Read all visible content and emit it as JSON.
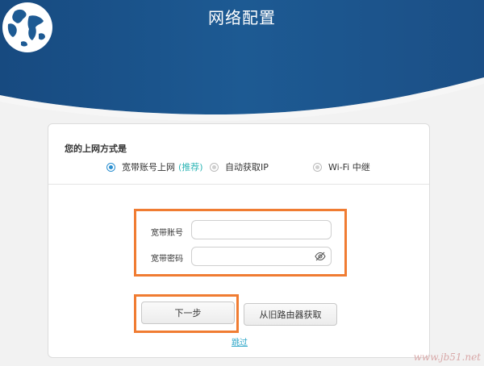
{
  "header": {
    "title": "网络配置"
  },
  "form": {
    "question": "您的上网方式是",
    "options": [
      {
        "label": "宽带账号上网",
        "tag": "(推荐)",
        "selected": true
      },
      {
        "label": "自动获取IP",
        "selected": false
      },
      {
        "label": "Wi-Fi 中继",
        "selected": false
      }
    ],
    "account_label": "宽带账号",
    "account_value": "",
    "password_label": "宽带密码",
    "password_value": ""
  },
  "actions": {
    "next_label": "下一步",
    "import_label": "从旧路由器获取",
    "skip_label": "跳过"
  },
  "watermark": "www.jb51.net",
  "colors": {
    "header_blue": "#1d4f86",
    "highlight_orange": "#f07c32",
    "link_teal": "#2fa7c9"
  }
}
